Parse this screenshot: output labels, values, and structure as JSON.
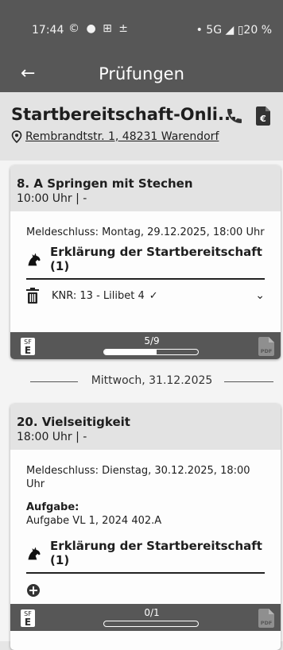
{
  "status_bar": {
    "time": "17:44",
    "left_icons": "© ● ⊞ ±",
    "right": "• 5G ◢ ▯20 %"
  },
  "app_bar": {
    "title": "Prüfungen"
  },
  "competition": {
    "title": "Startbereitschaft-Onli...",
    "address": "Rembrandtstr. 1, 48231 Warendorf"
  },
  "cards": [
    {
      "name": "8. A Springen mit Stechen",
      "time": "10:00 Uhr | -",
      "deadline_label": "Meldeschluss:",
      "deadline": "Montag, 29.12.2025, 18:00 Uhr",
      "declaration": "Erklärung der Startbereitschaft (1)",
      "entry": "KNR: 13 - Lilibet 4",
      "progress_label": "5/9",
      "progress": 0.56,
      "sf_top": "SF",
      "sf_bottom": "E",
      "pdf_label": "PDF"
    },
    {
      "name": "20. Vielseitigkeit",
      "time": "18:00 Uhr | -",
      "deadline_label": "Meldeschluss:",
      "deadline": "Dienstag, 30.12.2025, 18:00 Uhr",
      "task_label": "Aufgabe:",
      "task": "Aufgabe VL 1, 2024 402.A",
      "declaration": "Erklärung der Startbereitschaft (1)",
      "progress_label": "0/1",
      "progress": 0.0,
      "sf_top": "SF",
      "sf_bottom": "E",
      "pdf_label": "PDF"
    }
  ],
  "date_divider": "Mittwoch, 31.12.2025",
  "colors": {
    "bar": "#575757",
    "header": "#e3e3e3",
    "background": "#f4f4f4"
  },
  "icons": [
    "back-arrow-icon",
    "location-pin-icon",
    "phone-icon",
    "euro-document-icon",
    "horse-icon",
    "trash-icon",
    "check-icon",
    "chevron-down-icon",
    "add-circle-icon",
    "pdf-icon"
  ]
}
